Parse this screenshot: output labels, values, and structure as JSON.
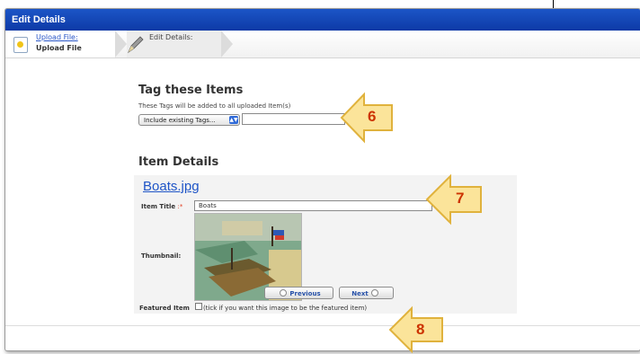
{
  "window": {
    "title": "Edit Details"
  },
  "wizard": {
    "steps": [
      {
        "link": "Upload File:",
        "sub": "Upload File"
      },
      {
        "label": "Edit Details:"
      }
    ]
  },
  "tags": {
    "title": "Tag these Items",
    "description": "These Tags will be added to all uploaded Item(s)",
    "select_value": "Include existing Tags...",
    "input_value": ""
  },
  "item_details": {
    "title": "Item Details",
    "file_name": "Boats.jpg",
    "title_label": "Item Title",
    "required_mark": ":*",
    "title_value": "Boats",
    "thumbnail_label": "Thumbnail:",
    "featured_label": "Featured Item",
    "featured_hint": "(tick if you want this image to be the featured item)"
  },
  "buttons": {
    "previous": "Previous",
    "next": "Next"
  },
  "callouts": [
    "6",
    "7",
    "8"
  ],
  "colors": {
    "titlebar": "#1c55c7",
    "link": "#1f55c7",
    "callout_fill": "#fbe49a",
    "callout_number": "#cc3300"
  }
}
